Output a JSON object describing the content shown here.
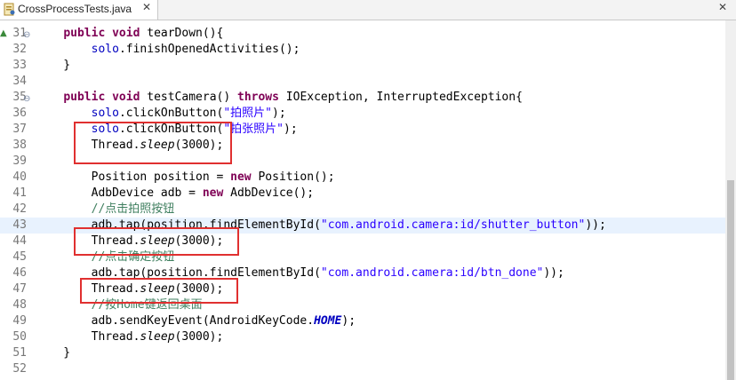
{
  "tab": {
    "title": "CrossProcessTests.java",
    "close": "✕",
    "icon": "java-file-icon"
  },
  "lines": [
    {
      "n": "31",
      "fold": "⊖",
      "arrow": "▲",
      "tokens": [
        {
          "t": "    "
        },
        {
          "t": "public",
          "c": "kw"
        },
        {
          "t": " "
        },
        {
          "t": "void",
          "c": "kw"
        },
        {
          "t": " tearDown(){"
        }
      ]
    },
    {
      "n": "32",
      "tokens": [
        {
          "t": "        "
        },
        {
          "t": "solo",
          "c": "fld"
        },
        {
          "t": ".finishOpenedActivities();"
        }
      ]
    },
    {
      "n": "33",
      "tokens": [
        {
          "t": "    }"
        }
      ]
    },
    {
      "n": "34",
      "tokens": [
        {
          "t": ""
        }
      ]
    },
    {
      "n": "35",
      "fold": "⊖",
      "tokens": [
        {
          "t": "    "
        },
        {
          "t": "public",
          "c": "kw"
        },
        {
          "t": " "
        },
        {
          "t": "void",
          "c": "kw"
        },
        {
          "t": " testCamera() "
        },
        {
          "t": "throws",
          "c": "kw"
        },
        {
          "t": " IOException, InterruptedException{"
        }
      ]
    },
    {
      "n": "36",
      "tokens": [
        {
          "t": "        "
        },
        {
          "t": "solo",
          "c": "fld"
        },
        {
          "t": ".clickOnButton("
        },
        {
          "t": "\"拍照片\"",
          "c": "str"
        },
        {
          "t": ");"
        }
      ]
    },
    {
      "n": "37",
      "tokens": [
        {
          "t": "        "
        },
        {
          "t": "solo",
          "c": "fld"
        },
        {
          "t": ".clickOnButton("
        },
        {
          "t": "\"拍张照片\"",
          "c": "str"
        },
        {
          "t": ");"
        }
      ]
    },
    {
      "n": "38",
      "tokens": [
        {
          "t": "        Thread."
        },
        {
          "t": "sleep",
          "c": "it"
        },
        {
          "t": "(3000);"
        }
      ]
    },
    {
      "n": "39",
      "tokens": [
        {
          "t": ""
        }
      ]
    },
    {
      "n": "40",
      "tokens": [
        {
          "t": "        Position position = "
        },
        {
          "t": "new",
          "c": "kw"
        },
        {
          "t": " Position();"
        }
      ]
    },
    {
      "n": "41",
      "tokens": [
        {
          "t": "        AdbDevice adb = "
        },
        {
          "t": "new",
          "c": "kw"
        },
        {
          "t": " AdbDevice();"
        }
      ]
    },
    {
      "n": "42",
      "tokens": [
        {
          "t": "        "
        },
        {
          "t": "//点击拍照按钮",
          "c": "cmt"
        }
      ]
    },
    {
      "n": "43",
      "current": true,
      "tokens": [
        {
          "t": "        adb.tap(position.findElementById("
        },
        {
          "t": "\"com.android.camera:id/shutter_button\"",
          "c": "str"
        },
        {
          "t": "));"
        }
      ]
    },
    {
      "n": "44",
      "tokens": [
        {
          "t": "        Thread."
        },
        {
          "t": "sleep",
          "c": "it"
        },
        {
          "t": "(3000);"
        }
      ]
    },
    {
      "n": "45",
      "tokens": [
        {
          "t": "        "
        },
        {
          "t": "//点击确定按钮",
          "c": "cmt"
        }
      ]
    },
    {
      "n": "46",
      "tokens": [
        {
          "t": "        adb.tap(position.findElementById("
        },
        {
          "t": "\"com.android.camera:id/btn_done\"",
          "c": "str"
        },
        {
          "t": "));"
        }
      ]
    },
    {
      "n": "47",
      "tokens": [
        {
          "t": "        Thread."
        },
        {
          "t": "sleep",
          "c": "it"
        },
        {
          "t": "(3000);"
        }
      ]
    },
    {
      "n": "48",
      "tokens": [
        {
          "t": "        "
        },
        {
          "t": "//按Home键返回桌面",
          "c": "cmt"
        }
      ]
    },
    {
      "n": "49",
      "tokens": [
        {
          "t": "        adb.sendKeyEvent(AndroidKeyCode."
        },
        {
          "t": "HOME",
          "c": "itb"
        },
        {
          "t": ");"
        }
      ]
    },
    {
      "n": "50",
      "tokens": [
        {
          "t": "        Thread."
        },
        {
          "t": "sleep",
          "c": "it"
        },
        {
          "t": "(3000);"
        }
      ]
    },
    {
      "n": "51",
      "tokens": [
        {
          "t": "    }"
        }
      ]
    },
    {
      "n": "52",
      "tokens": [
        {
          "t": ""
        }
      ]
    }
  ],
  "colors": {
    "highlight_box": "#e03030",
    "keyword": "#7f0055",
    "string": "#2a00ff",
    "comment": "#3f7f5f",
    "field": "#0000c0"
  }
}
